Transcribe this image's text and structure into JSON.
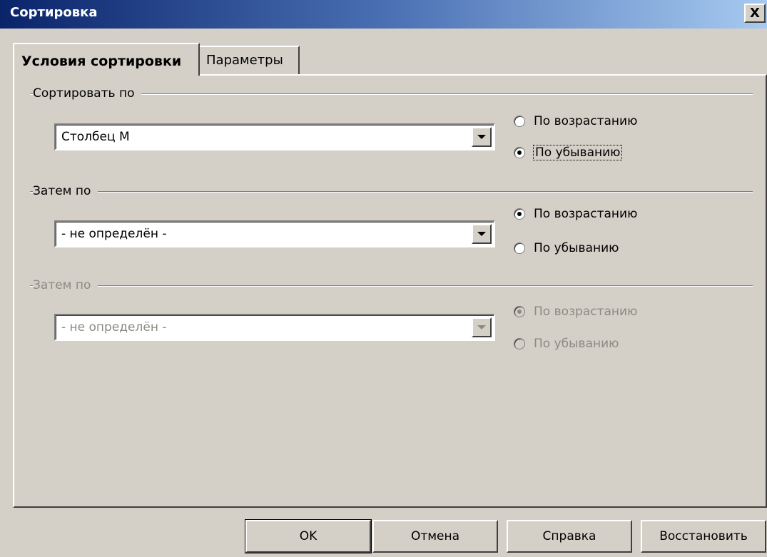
{
  "window": {
    "title": "Сортировка",
    "close_label": "X"
  },
  "tabs": [
    {
      "label": "Условия сортировки",
      "active": true
    },
    {
      "label": "Параметры",
      "active": false
    }
  ],
  "sections": [
    {
      "label": "Сортировать по",
      "combo_value": "Столбец M",
      "enabled": true,
      "asc_label": "По возрастанию",
      "desc_label": "По убыванию",
      "selected": "desc"
    },
    {
      "label": "Затем по",
      "combo_value": "- не определён -",
      "enabled": true,
      "asc_label": "По возрастанию",
      "desc_label": "По убыванию",
      "selected": "asc"
    },
    {
      "label": "Затем по",
      "combo_value": "- не определён -",
      "enabled": false,
      "asc_label": "По возрастанию",
      "desc_label": "По убыванию",
      "selected": "asc"
    }
  ],
  "buttons": {
    "ok": "OK",
    "cancel": "Отмена",
    "help": "Справка",
    "reset": "Восстановить"
  },
  "colors": {
    "face": "#d4d0c8",
    "title_start": "#0a246a",
    "title_end": "#a6caf0",
    "disabled_text": "#8d8a84"
  }
}
